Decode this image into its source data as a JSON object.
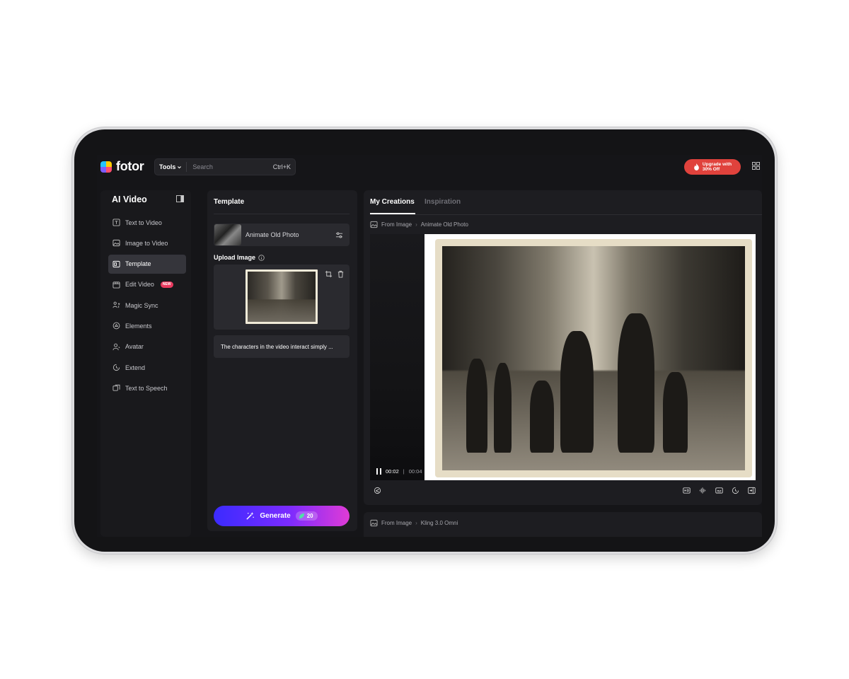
{
  "header": {
    "logo_text": "fotor",
    "tools_label": "Tools",
    "search_placeholder": "Search",
    "shortcut": "Ctrl+K",
    "upgrade_line1": "Upgrade with",
    "upgrade_line2": "30% Off"
  },
  "sidebar": {
    "title": "AI Video",
    "items": [
      {
        "label": "Text to Video",
        "icon": "text-to-video-icon"
      },
      {
        "label": "Image to Video",
        "icon": "image-icon"
      },
      {
        "label": "Template",
        "icon": "template-icon",
        "active": true
      },
      {
        "label": "Edit Video",
        "icon": "edit-video-icon",
        "badge": "NEW"
      },
      {
        "label": "Magic Sync",
        "icon": "magic-sync-icon"
      },
      {
        "label": "Elements",
        "icon": "elements-icon"
      },
      {
        "label": "Avatar",
        "icon": "avatar-icon"
      },
      {
        "label": "Extend",
        "icon": "extend-icon"
      },
      {
        "label": "Text to Speech",
        "icon": "text-to-speech-icon"
      }
    ]
  },
  "template_panel": {
    "title": "Template",
    "selected_template": "Animate Old Photo",
    "upload_label": "Upload Image",
    "prompt_text": "The characters in the video interact simply ...",
    "generate_label": "Generate",
    "credits": "20"
  },
  "creations_panel": {
    "tabs": [
      "My Creations",
      "Inspiration"
    ],
    "active_tab": "My Creations",
    "item1": {
      "crumb_source": "From Image",
      "crumb_target": "Animate Old Photo",
      "current_time": "00:02",
      "total_time": "00:04"
    },
    "item2": {
      "crumb_source": "From Image",
      "crumb_target": "Kling 3.0 Omni"
    }
  },
  "colors": {
    "background": "#151518",
    "panel": "#1d1d21",
    "accent_upgrade": "#e0423c",
    "generate_gradient_start": "#3b2bff",
    "generate_gradient_end": "#e03bd6"
  }
}
